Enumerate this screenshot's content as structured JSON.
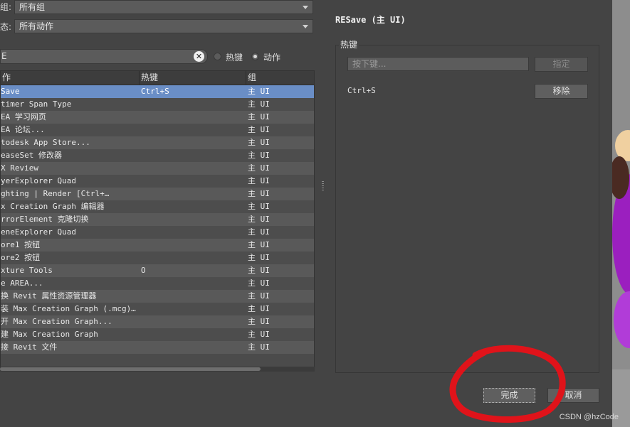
{
  "filters": {
    "group_label": "组:",
    "group_value": "所有组",
    "category_label": "态:",
    "category_value": "所有动作"
  },
  "search": {
    "text": "E",
    "clear_icon": "clear-x-icon"
  },
  "search_mode": {
    "options": [
      "热键",
      "动作"
    ],
    "selected": "动作"
  },
  "table": {
    "columns": [
      "作",
      "热键",
      "组"
    ],
    "rows": [
      {
        "action": "Save",
        "hotkey": "Ctrl+S",
        "group": "主 UI",
        "selected": true
      },
      {
        "action": "timer Span Type",
        "hotkey": "",
        "group": "主 UI"
      },
      {
        "action": "EA 学习网页",
        "hotkey": "",
        "group": "主 UI"
      },
      {
        "action": "EA 论坛...",
        "hotkey": "",
        "group": "主 UI"
      },
      {
        "action": "todesk App Store...",
        "hotkey": "",
        "group": "主 UI"
      },
      {
        "action": "easeSet 修改器",
        "hotkey": "",
        "group": "主 UI"
      },
      {
        "action": "X Review",
        "hotkey": "",
        "group": "主 UI"
      },
      {
        "action": "yerExplorer Quad",
        "hotkey": "",
        "group": "主 UI"
      },
      {
        "action": "ghting | Render        [Ctrl+…",
        "hotkey": "",
        "group": "主 UI"
      },
      {
        "action": "x Creation Graph  编辑器",
        "hotkey": "",
        "group": "主 UI"
      },
      {
        "action": "rrorElement 克隆切换",
        "hotkey": "",
        "group": "主 UI"
      },
      {
        "action": "eneExplorer Quad",
        "hotkey": "",
        "group": "主 UI"
      },
      {
        "action": "ore1 按钮",
        "hotkey": "",
        "group": "主 UI"
      },
      {
        "action": "ore2 按钮",
        "hotkey": "",
        "group": "主 UI"
      },
      {
        "action": "xture Tools",
        "hotkey": "O",
        "group": "主 UI"
      },
      {
        "action": "e AREA...",
        "hotkey": "",
        "group": "主 UI"
      },
      {
        "action": "换 Revit 属性资源管理器",
        "hotkey": "",
        "group": "主 UI"
      },
      {
        "action": "装 Max Creation Graph (.mcg)…",
        "hotkey": "",
        "group": "主 UI"
      },
      {
        "action": "开 Max Creation Graph...",
        "hotkey": "",
        "group": "主 UI"
      },
      {
        "action": "建 Max Creation Graph",
        "hotkey": "",
        "group": "主 UI"
      },
      {
        "action": "接 Revit 文件",
        "hotkey": "",
        "group": "主 UI"
      }
    ]
  },
  "detail": {
    "title": "RESave (主 UI)",
    "hotkey_group_label": "热键",
    "key_placeholder": "按下键...",
    "assign_label": "指定",
    "current_hotkey": "Ctrl+S",
    "remove_label": "移除"
  },
  "footer": {
    "done_label": "完成",
    "cancel_label": "取消"
  },
  "watermark": "CSDN @hzCode",
  "colors": {
    "panel_bg": "#444444",
    "selection": "#6a8ec6",
    "annotation_circle": "#e0131a"
  }
}
